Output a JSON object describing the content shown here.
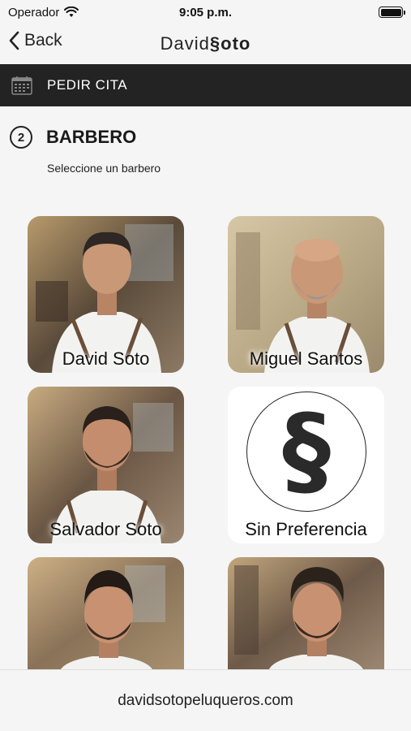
{
  "status_bar": {
    "carrier": "Operador",
    "time": "9:05 p.m."
  },
  "nav": {
    "back_label": "Back",
    "title_part1": "David",
    "title_part2": "§oto"
  },
  "section": {
    "label": "PEDIR CITA"
  },
  "step": {
    "number": "2",
    "title": "BARBERO",
    "subtitle": "Seleccione un barbero"
  },
  "barbers": [
    {
      "name": "David Soto"
    },
    {
      "name": "Miguel Santos"
    },
    {
      "name": "Salvador Soto"
    },
    {
      "name": "Sin Preferencia"
    },
    {
      "name": ""
    },
    {
      "name": ""
    }
  ],
  "footer": {
    "website": "davidsotopeluqueros.com"
  }
}
